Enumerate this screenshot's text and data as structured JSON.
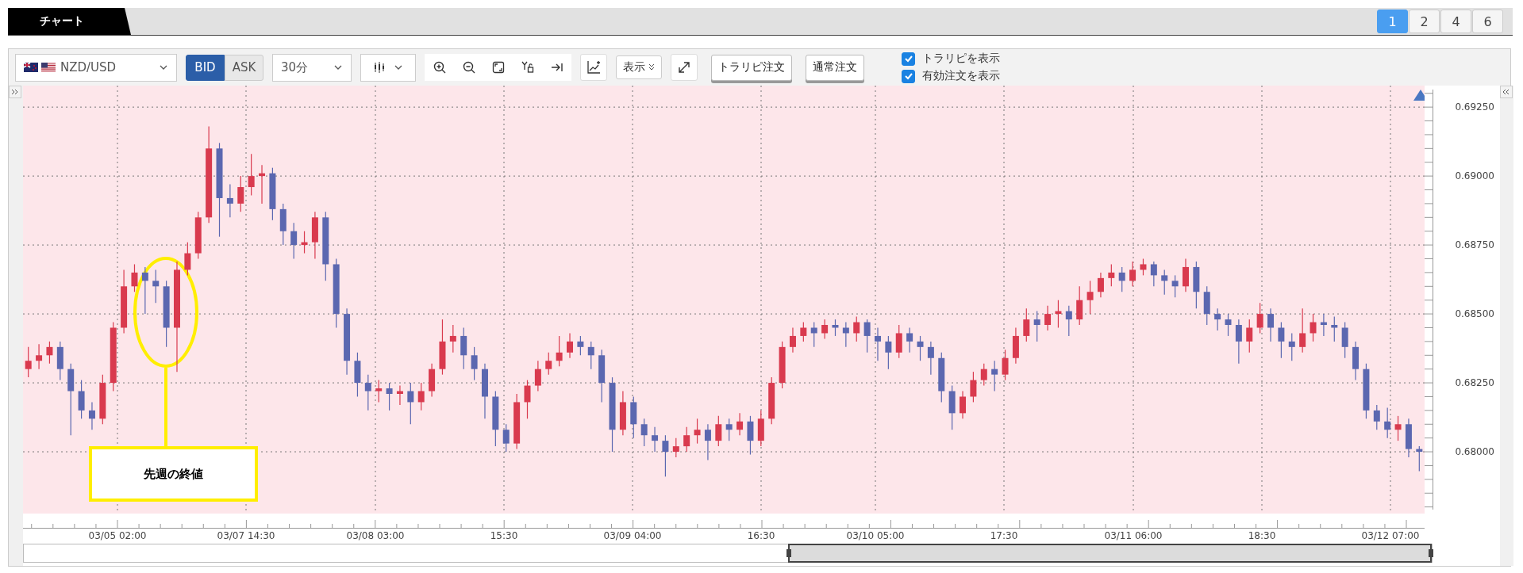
{
  "tab": {
    "label": "チャート"
  },
  "layout_buttons": [
    {
      "label": "1",
      "selected": true
    },
    {
      "label": "2",
      "selected": false
    },
    {
      "label": "4",
      "selected": false
    },
    {
      "label": "6",
      "selected": false
    }
  ],
  "toolbar": {
    "symbol": "NZD/USD",
    "price_sides": [
      {
        "label": "BID",
        "selected": true
      },
      {
        "label": "ASK",
        "selected": false
      }
    ],
    "timeframe": "30分",
    "display_menu": "表示",
    "order_buttons": [
      "トラリピ注文",
      "通常注文"
    ],
    "options": [
      {
        "label": "トラリピを表示",
        "checked": true
      },
      {
        "label": "有効注文を表示",
        "checked": true
      }
    ]
  },
  "chart": {
    "chart_data": {
      "type": "candlestick",
      "grid": true,
      "ylim": [
        0.67776,
        0.69328
      ],
      "yticks": [
        {
          "value": 0.6925,
          "label": "0.69250"
        },
        {
          "value": 0.69,
          "label": "0.69000"
        },
        {
          "value": 0.6875,
          "label": "0.68750"
        },
        {
          "value": 0.685,
          "label": "0.68500"
        },
        {
          "value": 0.6825,
          "label": "0.68250"
        },
        {
          "value": 0.68,
          "label": "0.68000"
        }
      ],
      "categories": [
        null,
        null,
        null,
        null,
        null,
        null,
        null,
        null,
        null,
        null,
        null,
        null,
        null,
        null,
        null,
        null,
        null,
        null,
        null,
        null,
        null,
        null,
        null,
        null,
        null,
        null,
        null,
        null,
        null,
        null,
        null,
        null,
        null,
        null,
        null,
        null,
        null,
        null,
        null,
        null,
        null,
        null,
        null,
        null,
        null,
        null,
        null,
        null,
        null,
        null,
        null,
        null,
        null,
        null,
        null,
        null,
        null,
        null,
        null,
        null,
        null,
        null,
        null,
        null,
        null,
        null,
        null,
        null,
        null,
        null,
        null,
        null,
        null,
        null,
        null,
        null,
        null,
        null,
        null,
        null,
        null,
        null,
        null,
        null,
        null,
        null,
        null,
        null,
        null,
        null,
        null,
        null,
        null,
        null,
        null,
        null,
        null,
        null,
        null,
        null,
        null,
        null,
        null,
        null,
        null,
        null,
        null,
        null,
        null,
        null,
        null,
        null,
        null,
        null,
        null,
        null,
        null,
        null,
        null,
        null,
        null,
        null,
        null,
        null,
        null,
        null,
        null,
        null,
        null,
        null,
        null,
        null
      ],
      "ohlc": [
        [
          0.683,
          0.6838,
          0.6827,
          0.6833
        ],
        [
          0.6833,
          0.6839,
          0.683,
          0.6835
        ],
        [
          0.6835,
          0.684,
          0.6832,
          0.6838
        ],
        [
          0.6838,
          0.684,
          0.6826,
          0.683
        ],
        [
          0.683,
          0.6832,
          0.6806,
          0.6822
        ],
        [
          0.6822,
          0.6826,
          0.6812,
          0.6815
        ],
        [
          0.6815,
          0.6818,
          0.6808,
          0.6812
        ],
        [
          0.6812,
          0.6828,
          0.681,
          0.6825
        ],
        [
          0.6825,
          0.6847,
          0.6822,
          0.6845
        ],
        [
          0.6845,
          0.6866,
          0.6843,
          0.686
        ],
        [
          0.686,
          0.6868,
          0.6858,
          0.6865
        ],
        [
          0.6865,
          0.6867,
          0.685,
          0.6862
        ],
        [
          0.6862,
          0.6866,
          0.6854,
          0.686
        ],
        [
          0.686,
          0.6862,
          0.6838,
          0.6845
        ],
        [
          0.6845,
          0.6869,
          0.6829,
          0.6866
        ],
        [
          0.6866,
          0.6876,
          0.6864,
          0.6872
        ],
        [
          0.6872,
          0.6887,
          0.687,
          0.6885
        ],
        [
          0.6885,
          0.6918,
          0.6883,
          0.691
        ],
        [
          0.691,
          0.6912,
          0.6878,
          0.6892
        ],
        [
          0.6892,
          0.6897,
          0.6885,
          0.689
        ],
        [
          0.689,
          0.69,
          0.6887,
          0.6896
        ],
        [
          0.6896,
          0.6908,
          0.6893,
          0.69
        ],
        [
          0.69,
          0.6904,
          0.689,
          0.6901
        ],
        [
          0.6901,
          0.6903,
          0.6884,
          0.6888
        ],
        [
          0.6888,
          0.689,
          0.6875,
          0.688
        ],
        [
          0.688,
          0.6883,
          0.687,
          0.6875
        ],
        [
          0.6875,
          0.688,
          0.6872,
          0.6876
        ],
        [
          0.6876,
          0.6887,
          0.687,
          0.6885
        ],
        [
          0.6885,
          0.6887,
          0.6862,
          0.6868
        ],
        [
          0.6868,
          0.687,
          0.6845,
          0.685
        ],
        [
          0.685,
          0.6852,
          0.6828,
          0.6833
        ],
        [
          0.6833,
          0.6836,
          0.682,
          0.6825
        ],
        [
          0.6825,
          0.6828,
          0.6815,
          0.6822
        ],
        [
          0.6822,
          0.6826,
          0.6818,
          0.6823
        ],
        [
          0.6823,
          0.6825,
          0.6815,
          0.6821
        ],
        [
          0.6821,
          0.6824,
          0.6817,
          0.6822
        ],
        [
          0.6822,
          0.6825,
          0.681,
          0.6818
        ],
        [
          0.6818,
          0.6825,
          0.6815,
          0.6822
        ],
        [
          0.6822,
          0.6832,
          0.682,
          0.683
        ],
        [
          0.683,
          0.6848,
          0.6828,
          0.684
        ],
        [
          0.684,
          0.6846,
          0.6836,
          0.6842
        ],
        [
          0.6842,
          0.6845,
          0.683,
          0.6835
        ],
        [
          0.6835,
          0.6838,
          0.6826,
          0.683
        ],
        [
          0.683,
          0.6832,
          0.6812,
          0.682
        ],
        [
          0.682,
          0.6822,
          0.6802,
          0.6808
        ],
        [
          0.6808,
          0.681,
          0.68,
          0.6803
        ],
        [
          0.6803,
          0.6821,
          0.6801,
          0.6818
        ],
        [
          0.6818,
          0.6826,
          0.6812,
          0.6824
        ],
        [
          0.6824,
          0.6833,
          0.6822,
          0.683
        ],
        [
          0.683,
          0.6836,
          0.6828,
          0.6833
        ],
        [
          0.6833,
          0.6842,
          0.6831,
          0.6836
        ],
        [
          0.6836,
          0.6843,
          0.6834,
          0.684
        ],
        [
          0.684,
          0.6842,
          0.6835,
          0.6838
        ],
        [
          0.6838,
          0.684,
          0.683,
          0.6835
        ],
        [
          0.6835,
          0.6837,
          0.6818,
          0.6825
        ],
        [
          0.6825,
          0.6827,
          0.68,
          0.6808
        ],
        [
          0.6808,
          0.6822,
          0.6806,
          0.6818
        ],
        [
          0.6818,
          0.682,
          0.6805,
          0.681
        ],
        [
          0.681,
          0.6812,
          0.6802,
          0.6806
        ],
        [
          0.6806,
          0.6809,
          0.68,
          0.6804
        ],
        [
          0.6804,
          0.6806,
          0.6791,
          0.68
        ],
        [
          0.68,
          0.6805,
          0.6798,
          0.6802
        ],
        [
          0.6802,
          0.6809,
          0.68,
          0.6806
        ],
        [
          0.6806,
          0.6812,
          0.6803,
          0.6808
        ],
        [
          0.6808,
          0.681,
          0.6797,
          0.6804
        ],
        [
          0.6804,
          0.6813,
          0.6802,
          0.681
        ],
        [
          0.681,
          0.6812,
          0.6804,
          0.6808
        ],
        [
          0.6808,
          0.6814,
          0.6806,
          0.6811
        ],
        [
          0.6811,
          0.6813,
          0.6799,
          0.6804
        ],
        [
          0.6804,
          0.6815,
          0.6802,
          0.6812
        ],
        [
          0.6812,
          0.6827,
          0.681,
          0.6825
        ],
        [
          0.6825,
          0.684,
          0.6823,
          0.6838
        ],
        [
          0.6838,
          0.6845,
          0.6836,
          0.6842
        ],
        [
          0.6842,
          0.6847,
          0.684,
          0.6845
        ],
        [
          0.6845,
          0.6847,
          0.6838,
          0.6843
        ],
        [
          0.6843,
          0.6848,
          0.6841,
          0.6846
        ],
        [
          0.6846,
          0.6848,
          0.6842,
          0.6845
        ],
        [
          0.6845,
          0.6847,
          0.6838,
          0.6843
        ],
        [
          0.6843,
          0.6849,
          0.684,
          0.6847
        ],
        [
          0.6847,
          0.6848,
          0.6836,
          0.6842
        ],
        [
          0.6842,
          0.6845,
          0.6833,
          0.684
        ],
        [
          0.684,
          0.6842,
          0.683,
          0.6836
        ],
        [
          0.6836,
          0.6846,
          0.6834,
          0.6843
        ],
        [
          0.6843,
          0.6845,
          0.6836,
          0.684
        ],
        [
          0.684,
          0.6842,
          0.6833,
          0.6838
        ],
        [
          0.6838,
          0.684,
          0.6828,
          0.6834
        ],
        [
          0.6834,
          0.6836,
          0.6818,
          0.6822
        ],
        [
          0.6822,
          0.6824,
          0.6808,
          0.6814
        ],
        [
          0.6814,
          0.6822,
          0.6812,
          0.682
        ],
        [
          0.682,
          0.6829,
          0.6818,
          0.6826
        ],
        [
          0.6826,
          0.6832,
          0.6824,
          0.683
        ],
        [
          0.683,
          0.6833,
          0.6822,
          0.6828
        ],
        [
          0.6828,
          0.6837,
          0.6826,
          0.6834
        ],
        [
          0.6834,
          0.6845,
          0.6832,
          0.6842
        ],
        [
          0.6842,
          0.6852,
          0.684,
          0.6848
        ],
        [
          0.6848,
          0.6851,
          0.684,
          0.6846
        ],
        [
          0.6846,
          0.6853,
          0.6844,
          0.685
        ],
        [
          0.685,
          0.6855,
          0.6845,
          0.6851
        ],
        [
          0.6851,
          0.6853,
          0.6842,
          0.6848
        ],
        [
          0.6848,
          0.686,
          0.6846,
          0.6855
        ],
        [
          0.6855,
          0.6862,
          0.685,
          0.6858
        ],
        [
          0.6858,
          0.6865,
          0.6856,
          0.6863
        ],
        [
          0.6863,
          0.6868,
          0.686,
          0.6865
        ],
        [
          0.6865,
          0.6867,
          0.6858,
          0.6862
        ],
        [
          0.6862,
          0.6869,
          0.686,
          0.6866
        ],
        [
          0.6866,
          0.687,
          0.6864,
          0.6868
        ],
        [
          0.6868,
          0.6869,
          0.686,
          0.6864
        ],
        [
          0.6864,
          0.6866,
          0.6857,
          0.6862
        ],
        [
          0.6862,
          0.6864,
          0.6856,
          0.686
        ],
        [
          0.686,
          0.687,
          0.6858,
          0.6867
        ],
        [
          0.6867,
          0.6869,
          0.6852,
          0.6858
        ],
        [
          0.6858,
          0.686,
          0.6846,
          0.685
        ],
        [
          0.685,
          0.6852,
          0.6844,
          0.6848
        ],
        [
          0.6848,
          0.685,
          0.6842,
          0.6846
        ],
        [
          0.6846,
          0.6848,
          0.6832,
          0.684
        ],
        [
          0.684,
          0.6848,
          0.6836,
          0.6845
        ],
        [
          0.6845,
          0.6854,
          0.6843,
          0.685
        ],
        [
          0.685,
          0.6852,
          0.684,
          0.6845
        ],
        [
          0.6845,
          0.6847,
          0.6834,
          0.684
        ],
        [
          0.684,
          0.6843,
          0.6833,
          0.6838
        ],
        [
          0.6838,
          0.6852,
          0.6836,
          0.6843
        ],
        [
          0.6843,
          0.685,
          0.684,
          0.6847
        ],
        [
          0.6847,
          0.685,
          0.6842,
          0.6846
        ],
        [
          0.6846,
          0.6849,
          0.684,
          0.6845
        ],
        [
          0.6845,
          0.6847,
          0.6834,
          0.6838
        ],
        [
          0.6838,
          0.684,
          0.6826,
          0.683
        ],
        [
          0.683,
          0.6832,
          0.6812,
          0.6815
        ],
        [
          0.6815,
          0.6817,
          0.6808,
          0.6811
        ],
        [
          0.6811,
          0.6816,
          0.6805,
          0.6808
        ],
        [
          0.6808,
          0.6813,
          0.6804,
          0.681
        ],
        [
          0.681,
          0.6812,
          0.6798,
          0.6801
        ],
        [
          0.6801,
          0.6802,
          0.6793,
          0.68
        ]
      ]
    },
    "x_axis_labels": [
      "03/05 02:00",
      "03/07 14:30",
      "03/08 03:00",
      "15:30",
      "03/09 04:00",
      "16:30",
      "03/10 05:00",
      "17:30",
      "03/11 06:00",
      "18:30",
      "03/12 07:00"
    ],
    "callout": {
      "text": "先週の終値"
    }
  }
}
